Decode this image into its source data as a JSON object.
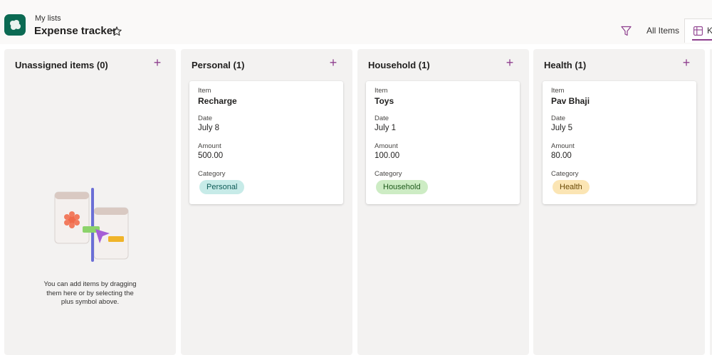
{
  "header": {
    "breadcrumb": "My lists",
    "title": "Expense tracker",
    "views": {
      "all_items": "All Items",
      "active_view_label": "K"
    }
  },
  "columns": [
    {
      "title": "Unassigned items (0)",
      "empty_message": "You can add items by dragging them here or by selecting the plus symbol above."
    },
    {
      "title": "Personal (1)",
      "card": {
        "item_label": "Item",
        "item": "Recharge",
        "date_label": "Date",
        "date": "July 8",
        "amount_label": "Amount",
        "amount": "500.00",
        "category_label": "Category",
        "category": "Personal"
      }
    },
    {
      "title": "Household (1)",
      "card": {
        "item_label": "Item",
        "item": "Toys",
        "date_label": "Date",
        "date": "July 1",
        "amount_label": "Amount",
        "amount": "100.00",
        "category_label": "Category",
        "category": "Household"
      }
    },
    {
      "title": "Health (1)",
      "card": {
        "item_label": "Item",
        "item": "Pav Bhaji",
        "date_label": "Date",
        "date": "July 5",
        "amount_label": "Amount",
        "amount": "80.00",
        "category_label": "Category",
        "category": "Health"
      }
    }
  ],
  "colors": {
    "accent": "#8e3f8e",
    "app_icon": "#0b6a53",
    "personal_pill_bg": "#c7ebe8",
    "personal_pill_text": "#0e5b57",
    "household_pill_bg": "#cdecc4",
    "household_pill_text": "#1f5a1c",
    "health_pill_bg": "#fbe5b4",
    "health_pill_text": "#6a4a06"
  },
  "icons": {
    "app": "list-app-icon",
    "favorite": "star-icon",
    "filter": "filter-icon",
    "board": "board-view-icon",
    "add": "plus-icon"
  }
}
